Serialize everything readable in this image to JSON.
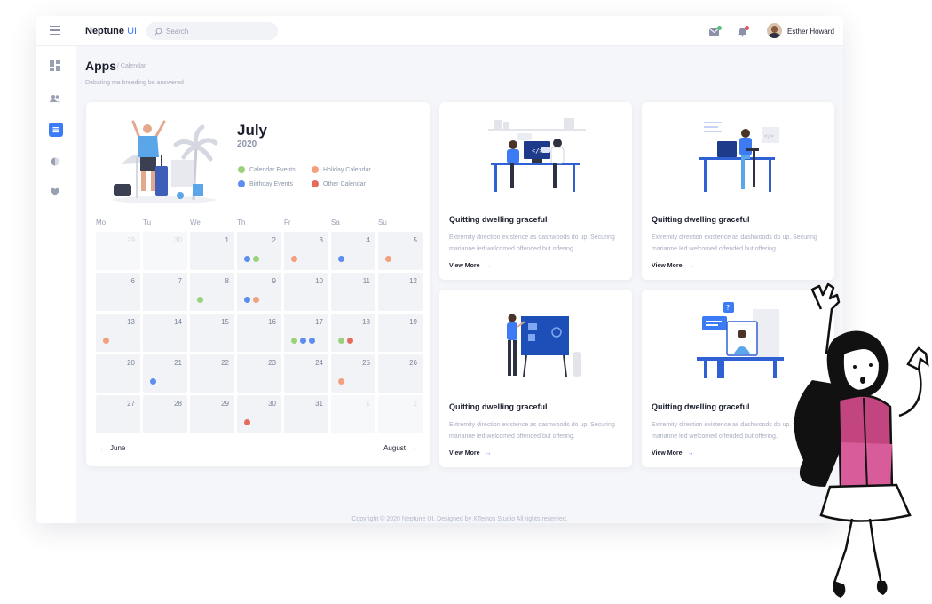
{
  "topbar": {
    "brand_main": "Neptune",
    "brand_accent": "UI",
    "search_placeholder": "Search",
    "user_name": "Esther Howard"
  },
  "icons": {
    "menu": "hamburger-icon",
    "mail": "mail-icon",
    "notifications": "bell-icon",
    "sidebar": [
      "dashboard-icon",
      "users-icon",
      "apps-icon",
      "moon-icon",
      "heart-icon"
    ]
  },
  "page": {
    "title": "Apps",
    "breadcrumb": "/ Calendar",
    "subtitle": "Debating me breeding be answered"
  },
  "calendar": {
    "month": "July",
    "year": "2020",
    "legend": [
      {
        "label": "Calendar Events",
        "color": "#9ad27a"
      },
      {
        "label": "Holiday Calendar",
        "color": "#f4a07e"
      },
      {
        "label": "Birthday Events",
        "color": "#5b8ef0"
      },
      {
        "label": "Other Calendar",
        "color": "#e66a5e"
      }
    ],
    "weekdays": [
      "Mo",
      "Tu",
      "We",
      "Th",
      "Fr",
      "Sa",
      "Su"
    ],
    "weeks": [
      [
        {
          "d": "29",
          "off": true
        },
        {
          "d": "30",
          "off": true
        },
        {
          "d": "1"
        },
        {
          "d": "2",
          "ev": [
            "blue",
            "green"
          ]
        },
        {
          "d": "3",
          "ev": [
            "orange"
          ]
        },
        {
          "d": "4",
          "ev": [
            "blue"
          ]
        },
        {
          "d": "5",
          "ev": [
            "orange"
          ]
        }
      ],
      [
        {
          "d": "6"
        },
        {
          "d": "7"
        },
        {
          "d": "8",
          "ev": [
            "green"
          ]
        },
        {
          "d": "9",
          "ev": [
            "blue",
            "orange"
          ]
        },
        {
          "d": "10"
        },
        {
          "d": "11"
        },
        {
          "d": "12"
        }
      ],
      [
        {
          "d": "13",
          "ev": [
            "orange"
          ]
        },
        {
          "d": "14"
        },
        {
          "d": "15"
        },
        {
          "d": "16"
        },
        {
          "d": "17",
          "ev": [
            "green",
            "blue",
            "blue"
          ]
        },
        {
          "d": "18",
          "ev": [
            "green",
            "red"
          ]
        },
        {
          "d": "19"
        }
      ],
      [
        {
          "d": "20"
        },
        {
          "d": "21",
          "ev": [
            "blue"
          ]
        },
        {
          "d": "22"
        },
        {
          "d": "23"
        },
        {
          "d": "24"
        },
        {
          "d": "25",
          "ev": [
            "orange"
          ]
        },
        {
          "d": "26"
        }
      ],
      [
        {
          "d": "27"
        },
        {
          "d": "28"
        },
        {
          "d": "29"
        },
        {
          "d": "30",
          "ev": [
            "red"
          ]
        },
        {
          "d": "31"
        },
        {
          "d": "1",
          "off": true
        },
        {
          "d": "2",
          "off": true
        }
      ]
    ],
    "prev_label": "June",
    "next_label": "August",
    "event_colors": {
      "blue": "#5b8ef0",
      "green": "#9ad27a",
      "orange": "#f4a07e",
      "red": "#e66a5e"
    }
  },
  "events": [
    {
      "title": "Quitting dwelling graceful",
      "desc": "Extremity direction existence as dashwoods do up. Securing marianne led welcomed offended but offering.",
      "more": "View More"
    },
    {
      "title": "Quitting dwelling graceful",
      "desc": "Extremity direction existence as dashwoods do up. Securing marianne led welcomed offended but offering.",
      "more": "View More"
    },
    {
      "title": "Quitting dwelling graceful",
      "desc": "Extremity direction existence as dashwoods do up. Securing marianne led welcomed offended but offering.",
      "more": "View More"
    },
    {
      "title": "Quitting dwelling graceful",
      "desc": "Extremity direction existence as dashwoods do up. Securing marianne led welcomed offended but offering.",
      "more": "View More"
    }
  ],
  "footer": "Copyright © 2020 Neptune UI. Designed by XTemos Studio All rights reserved.",
  "colors": {
    "accent": "#3d7bf5",
    "background": "#f5f6f9"
  }
}
